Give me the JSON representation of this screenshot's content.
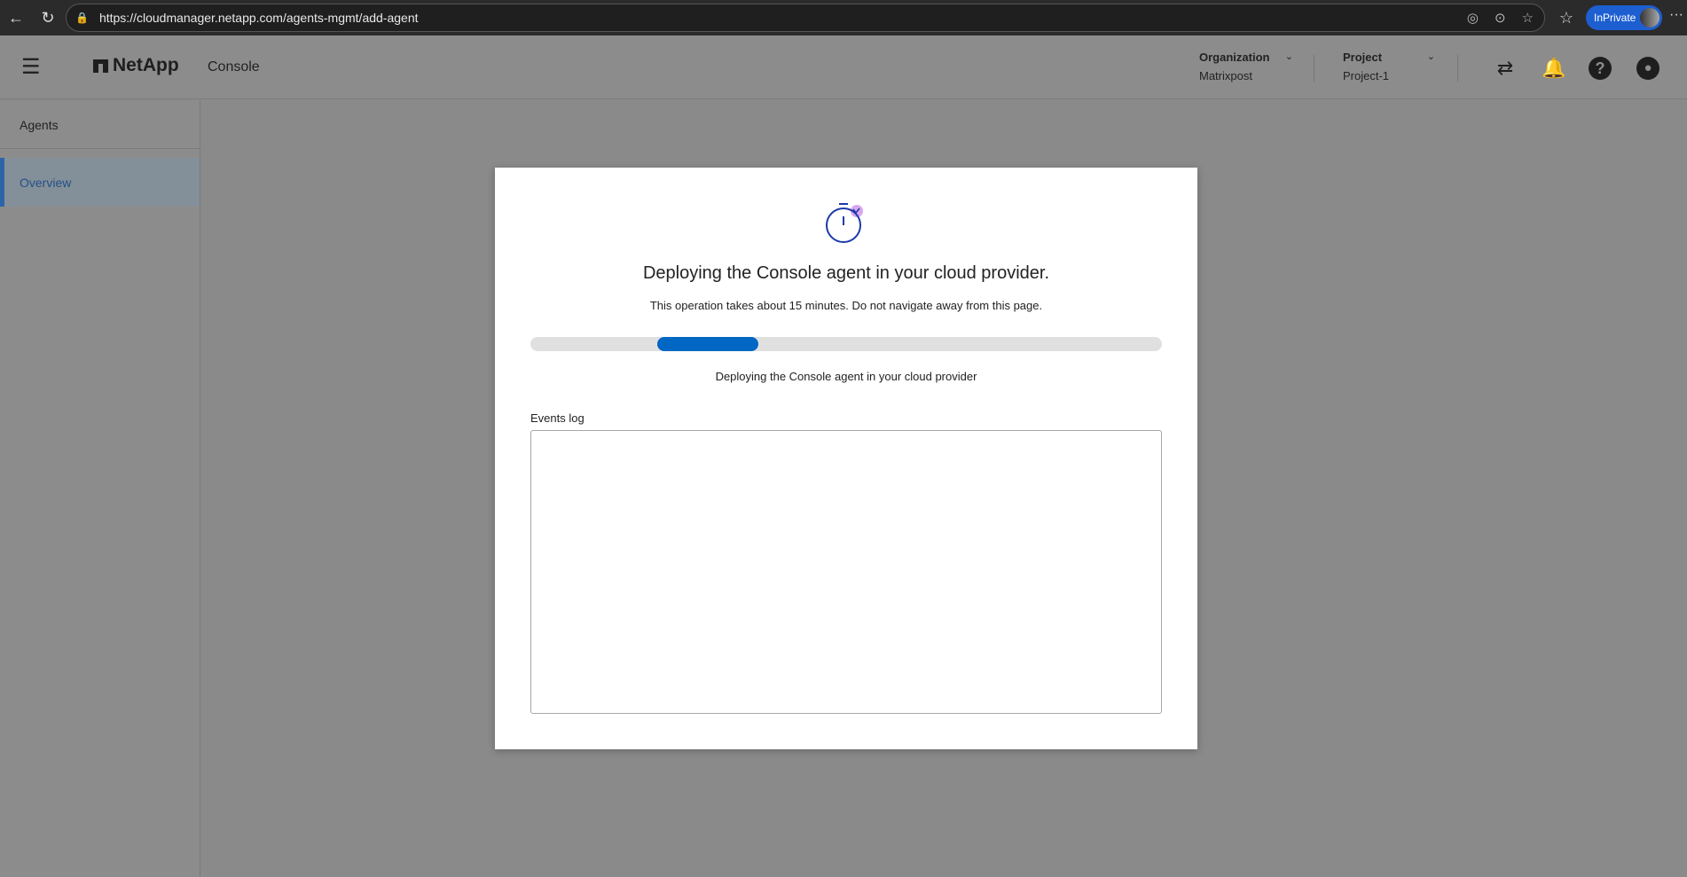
{
  "browser": {
    "url": "https://cloudmanager.netapp.com/agents-mgmt/add-agent",
    "inprivate_label": "InPrivate"
  },
  "header": {
    "brand": "NetApp",
    "product": "Console",
    "organization": {
      "label": "Organization",
      "value": "Matrixpost"
    },
    "project": {
      "label": "Project",
      "value": "Project-1"
    }
  },
  "sidebar": {
    "section": "Agents",
    "items": [
      {
        "label": "Overview",
        "active": true
      }
    ]
  },
  "modal": {
    "title": "Deploying the Console agent in your cloud provider.",
    "subtitle": "This operation takes about 15 minutes. Do not navigate away from this page.",
    "progress": {
      "mode": "indeterminate",
      "color": "#0067c5"
    },
    "status": "Deploying the Console agent in your cloud provider",
    "events_log_label": "Events log",
    "events_log_value": ""
  }
}
